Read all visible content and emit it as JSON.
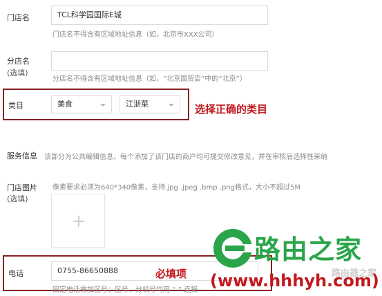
{
  "store_name": {
    "label": "门店名",
    "value": "TCL科学园国际E城",
    "hint": "门店名不得含有区域地址信息（如，北京市XXX公司）"
  },
  "branch_name": {
    "label": "分店名",
    "optional": "(选填)",
    "value": "",
    "hint": "分店名不得含有区域地址信息（如，“北京国贸店”中的“北京”）"
  },
  "category": {
    "label": "类目",
    "primary": "美食",
    "secondary": "江浙菜",
    "annotation": "选择正确的类目"
  },
  "service_info": {
    "label": "服务信息",
    "desc": "该部分为公共编辑信息，每个添加了该门店的商户均可提交修改意见，并在审核后选择性采纳"
  },
  "store_photos": {
    "label": "门店图片",
    "optional": "(选填)",
    "hint": "像素要求必须为640*340像素，支持.jpg .jpeg .bmp .png格式，大小不超过5M",
    "add_symbol": "+"
  },
  "phone": {
    "label": "电话",
    "value": "0755-86650888",
    "annotation": "必填项",
    "hint": "固定电话需加区号；区号、分机号均用 “-” 连接"
  },
  "watermark": {
    "brand": "路由之家",
    "url": "(www.hhhyh.com)",
    "faint": "路由器之家"
  },
  "colors": {
    "annotation_red": "#c2191f",
    "box_red": "#8a1f25",
    "logo_green": "#2aa54a"
  }
}
